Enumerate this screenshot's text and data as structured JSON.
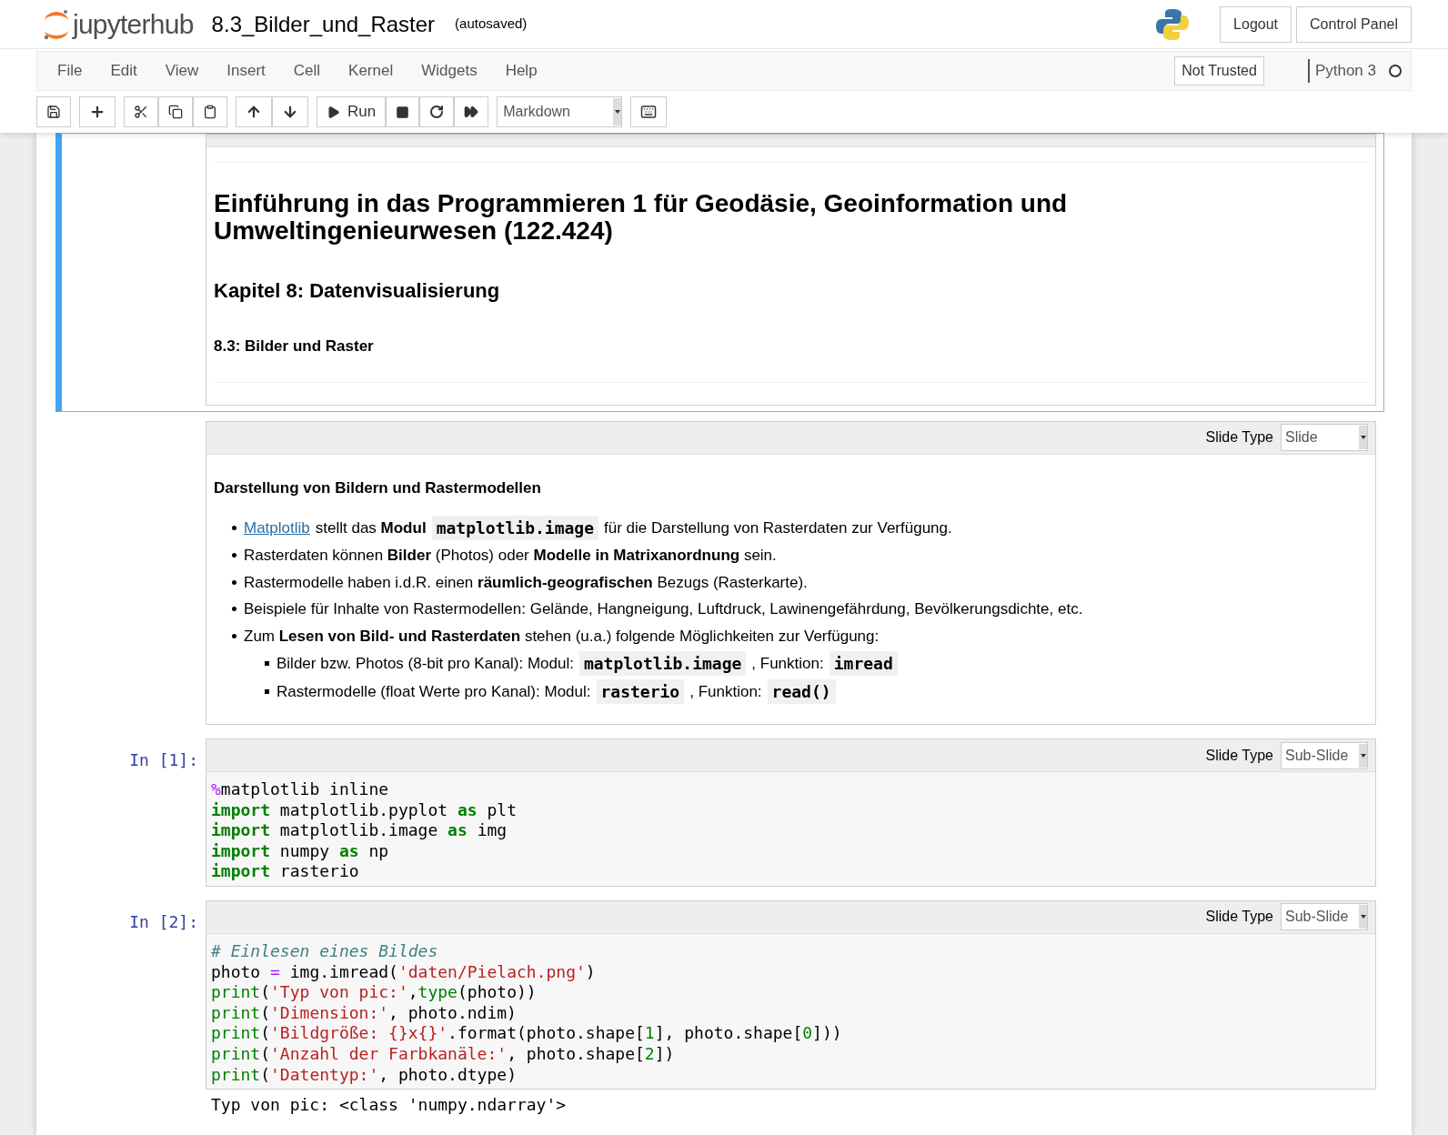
{
  "header": {
    "logo": "jupyterhub",
    "notebook_title": "8.3_Bilder_und_Raster",
    "save_status": "(autosaved)",
    "buttons": [
      "Logout",
      "Control Panel"
    ]
  },
  "menu": [
    "File",
    "Edit",
    "View",
    "Insert",
    "Cell",
    "Kernel",
    "Widgets",
    "Help"
  ],
  "trust": "Not Trusted",
  "kernel": {
    "name": "Python 3",
    "busy": false
  },
  "toolbar": {
    "run_label": "Run",
    "cell_type": "Markdown"
  },
  "cells": [
    {
      "kind": "title",
      "selected": true,
      "h1": "Einführung in das Programmieren 1 für Geodäsie, Geoinformation und Umweltingenieurwesen (122.424)",
      "h2": "Kapitel 8: Datenvisualisierung",
      "h4": "8.3: Bilder und Raster"
    },
    {
      "kind": "markdown",
      "selected": false,
      "slide_label": "Slide Type",
      "slide_type": "Slide",
      "heading": "Darstellung von Bildern und Rastermodellen",
      "bullets": [
        {
          "segments": [
            {
              "kind": "link",
              "text": "Matplotlib"
            },
            {
              "kind": "text",
              "text": "stellt das **Modul**"
            },
            {
              "kind": "code",
              "text": "matplotlib.image"
            },
            {
              "kind": "text",
              "text": "für die Darstellung von Rasterdaten zur Verfügung."
            }
          ]
        },
        {
          "segments": [
            {
              "kind": "text",
              "text": "Rasterdaten können **Bilder** (Photos) oder **Modelle in Matrixanordnung** sein."
            }
          ]
        },
        {
          "segments": [
            {
              "kind": "text",
              "text": "Rastermodelle haben i.d.R. einen **räumlich-geografischen** Bezugs (Rasterkarte)."
            }
          ]
        },
        {
          "segments": [
            {
              "kind": "text",
              "text": "Beispiele für Inhalte von Rastermodellen: Gelände, Hangneigung, Luftdruck, Lawinengefährdung, Bevölkerungsdichte, etc."
            }
          ]
        },
        {
          "segments": [
            {
              "kind": "text",
              "text": "Zum **Lesen von Bild- und Rasterdaten** stehen (u.a.) folgende Möglichkeiten zur Verfügung:"
            }
          ],
          "children": [
            {
              "segments": [
                {
                  "kind": "text",
                  "text": "Bilder bzw. Photos (8-bit pro Kanal): Modul:"
                },
                {
                  "kind": "code",
                  "text": "matplotlib.image"
                },
                {
                  "kind": "text",
                  "text": ", Funktion:"
                },
                {
                  "kind": "code",
                  "text": "imread"
                }
              ]
            },
            {
              "segments": [
                {
                  "kind": "text",
                  "text": "Rastermodelle (float Werte pro Kanal): Modul:"
                },
                {
                  "kind": "code",
                  "text": "rasterio"
                },
                {
                  "kind": "text",
                  "text": ", Funktion:"
                },
                {
                  "kind": "code",
                  "text": "read()"
                }
              ]
            }
          ]
        }
      ]
    },
    {
      "kind": "code",
      "selected": false,
      "prompt": "In [1]:",
      "slide_label": "Slide Type",
      "slide_type": "Sub-Slide",
      "lines": [
        [
          {
            "kind": "magic",
            "text": "%"
          },
          {
            "kind": "plain",
            "text": "matplotlib inline"
          }
        ],
        [
          {
            "kind": "kw",
            "text": "import"
          },
          {
            "kind": "plain",
            "text": " matplotlib.pyplot "
          },
          {
            "kind": "kw",
            "text": "as"
          },
          {
            "kind": "plain",
            "text": " plt"
          }
        ],
        [
          {
            "kind": "kw",
            "text": "import"
          },
          {
            "kind": "plain",
            "text": " matplotlib.image "
          },
          {
            "kind": "kw",
            "text": "as"
          },
          {
            "kind": "plain",
            "text": " img"
          }
        ],
        [
          {
            "kind": "kw",
            "text": "import"
          },
          {
            "kind": "plain",
            "text": " numpy "
          },
          {
            "kind": "kw",
            "text": "as"
          },
          {
            "kind": "plain",
            "text": " np"
          }
        ],
        [
          {
            "kind": "kw",
            "text": "import"
          },
          {
            "kind": "plain",
            "text": " rasterio"
          }
        ]
      ]
    },
    {
      "kind": "code",
      "selected": false,
      "prompt": "In [2]:",
      "slide_label": "Slide Type",
      "slide_type": "Sub-Slide",
      "lines": [
        [
          {
            "kind": "comment",
            "text": "# Einlesen eines Bildes"
          }
        ],
        [
          {
            "kind": "plain",
            "text": "photo "
          },
          {
            "kind": "op",
            "text": "="
          },
          {
            "kind": "plain",
            "text": " img.imread("
          },
          {
            "kind": "str",
            "text": "'daten/Pielach.png'"
          },
          {
            "kind": "plain",
            "text": ")"
          }
        ],
        [
          {
            "kind": "builtin",
            "text": "print"
          },
          {
            "kind": "plain",
            "text": "("
          },
          {
            "kind": "str",
            "text": "'Typ von pic:'"
          },
          {
            "kind": "plain",
            "text": ","
          },
          {
            "kind": "builtin",
            "text": "type"
          },
          {
            "kind": "plain",
            "text": "(photo))"
          }
        ],
        [
          {
            "kind": "builtin",
            "text": "print"
          },
          {
            "kind": "plain",
            "text": "("
          },
          {
            "kind": "str",
            "text": "'Dimension:'"
          },
          {
            "kind": "plain",
            "text": ", photo.ndim)"
          }
        ],
        [
          {
            "kind": "builtin",
            "text": "print"
          },
          {
            "kind": "plain",
            "text": "("
          },
          {
            "kind": "str",
            "text": "'Bildgröße: {}x{}'"
          },
          {
            "kind": "plain",
            "text": ".format(photo.shape["
          },
          {
            "kind": "num",
            "text": "1"
          },
          {
            "kind": "plain",
            "text": "], photo.shape["
          },
          {
            "kind": "num",
            "text": "0"
          },
          {
            "kind": "plain",
            "text": "]))"
          }
        ],
        [
          {
            "kind": "builtin",
            "text": "print"
          },
          {
            "kind": "plain",
            "text": "("
          },
          {
            "kind": "str",
            "text": "'Anzahl der Farbkanäle:'"
          },
          {
            "kind": "plain",
            "text": ", photo.shape["
          },
          {
            "kind": "num",
            "text": "2"
          },
          {
            "kind": "plain",
            "text": "])"
          }
        ],
        [
          {
            "kind": "builtin",
            "text": "print"
          },
          {
            "kind": "plain",
            "text": "("
          },
          {
            "kind": "str",
            "text": "'Datentyp:'"
          },
          {
            "kind": "plain",
            "text": ", photo.dtype)"
          }
        ]
      ],
      "output": "Typ von pic: <class 'numpy.ndarray'>"
    }
  ]
}
